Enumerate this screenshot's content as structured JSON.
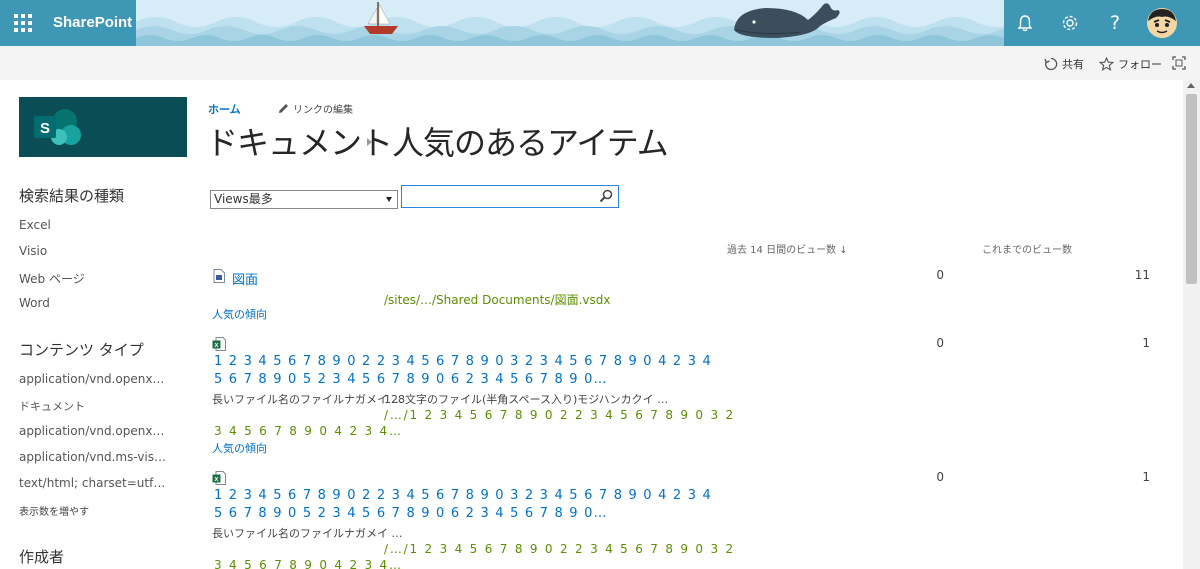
{
  "suitebar": {
    "app_name": "SharePoint"
  },
  "actions": {
    "share": "共有",
    "follow": "フォロー"
  },
  "breadcrumb": {
    "home": "ホーム",
    "edit_links": "リンクの編集"
  },
  "title": {
    "library": "ドキュメント",
    "page": "人気のあるアイテム"
  },
  "controls": {
    "sort_selected": "Views最多",
    "search_value": ""
  },
  "columns": {
    "recent_views": "過去 14 日間のビュー数 ↓",
    "lifetime_views": "これまでのビュー数"
  },
  "refiners": {
    "result_type": {
      "title": "検索結果の種類",
      "items": [
        "Excel",
        "Visio",
        "Web ページ",
        "Word"
      ]
    },
    "content_type": {
      "title": "コンテンツ タイプ",
      "items": [
        "application/vnd.openx…",
        "ドキュメント",
        "application/vnd.openx…",
        "application/vnd.ms-vis…",
        "text/html; charset=utf…"
      ],
      "more": "表示数を増やす"
    },
    "author": {
      "title": "作成者"
    }
  },
  "results": [
    {
      "title": "図面",
      "path": "/sites/…/Shared Documents/図面.vsdx",
      "trend": "人気の傾向",
      "recent_views": "0",
      "lifetime_views": "11",
      "icon": "visio-file-icon"
    },
    {
      "title_line1": "1 2 3 4 5 6 7 8 9 0 2 2 3 4 5 6 7 8 9 0 3 2 3 4 5 6 7 8 9 0 4 2 3 4",
      "title_line2": "5 6 7 8 9 0 5 2 3 4 5 6 7 8 9 0 6 2 3 4 5 6 7 8 9 0…",
      "snippet_a": "長いファイル名のファイルナガメイ …",
      "snippet_b": "128文字のファイル(半角スペース入り)モジハンカクイ …",
      "path_line1": "/…/1 2 3 4 5 6 7 8 9 0 2 2 3 4 5 6 7 8 9 0 3 2",
      "path_line2": "3 4 5 6 7 8 9 0 4 2 3 4…",
      "trend": "人気の傾向",
      "recent_views": "0",
      "lifetime_views": "1",
      "icon": "excel-file-icon"
    },
    {
      "title_line1": "1 2 3 4 5 6 7 8 9 0 2 2 3 4 5 6 7 8 9 0 3 2 3 4 5 6 7 8 9 0 4 2 3 4",
      "title_line2": "5 6 7 8 9 0 5 2 3 4 5 6 7 8 9 0 6 2 3 4 5 6 7 8 9 0…",
      "snippet_a": "長いファイル名のファイルナガメイ …",
      "path_line1": "/…/1 2 3 4 5 6 7 8 9 0 2 2 3 4 5 6 7 8 9 0 3 2",
      "path_line2": "3 4 5 6 7 8 9 0 4 2 3 4…",
      "recent_views": "0",
      "lifetime_views": "1",
      "icon": "excel-file-icon"
    }
  ]
}
